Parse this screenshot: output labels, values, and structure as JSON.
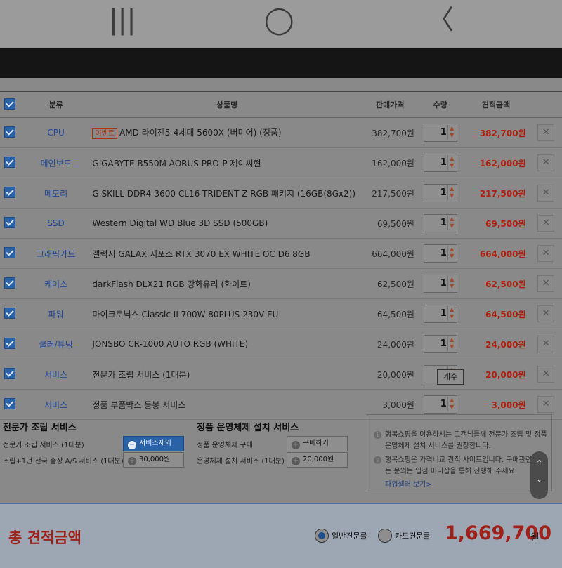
{
  "headers": {
    "select": "",
    "category": "분류",
    "product": "상품명",
    "price": "판매가격",
    "qty": "수량",
    "total": "견적금액"
  },
  "items": [
    {
      "category": "CPU",
      "badge": "이벤트",
      "name": "AMD 라이젠5-4세대 5600X (버미어) (정품)",
      "price": "382,700원",
      "qty": "1",
      "total": "382,700원"
    },
    {
      "category": "메인보드",
      "badge": "",
      "name": "GIGABYTE B550M AORUS PRO-P 제이씨현",
      "price": "162,000원",
      "qty": "1",
      "total": "162,000원"
    },
    {
      "category": "메모리",
      "badge": "",
      "name": "G.SKILL DDR4-3600 CL16 TRIDENT Z RGB 패키지 (16GB(8Gx2))",
      "price": "217,500원",
      "qty": "1",
      "total": "217,500원"
    },
    {
      "category": "SSD",
      "badge": "",
      "name": "Western Digital WD Blue 3D SSD (500GB)",
      "price": "69,500원",
      "qty": "1",
      "total": "69,500원"
    },
    {
      "category": "그래픽카드",
      "badge": "",
      "name": "갤럭시 GALAX 지포스 RTX 3070 EX WHITE OC D6 8GB",
      "price": "664,000원",
      "qty": "1",
      "total": "664,000원"
    },
    {
      "category": "케이스",
      "badge": "",
      "name": "darkFlash DLX21 RGB 강화유리 (화이트)",
      "price": "62,500원",
      "qty": "1",
      "total": "62,500원"
    },
    {
      "category": "파워",
      "badge": "",
      "name": "마이크로닉스 Classic II 700W 80PLUS 230V EU",
      "price": "64,500원",
      "qty": "1",
      "total": "64,500원"
    },
    {
      "category": "쿨러/튜닝",
      "badge": "",
      "name": "JONSBO CR-1000 AUTO RGB (WHITE)",
      "price": "24,000원",
      "qty": "1",
      "total": "24,000원"
    },
    {
      "category": "서비스",
      "badge": "",
      "name": "전문가 조립 서비스 (1대분)",
      "price": "20,000원",
      "qty": "1",
      "total": "20,000원"
    },
    {
      "category": "서비스",
      "badge": "",
      "name": "정품 부품박스 동봉 서비스",
      "price": "3,000원",
      "qty": "1",
      "total": "3,000원"
    }
  ],
  "tooltip": "개수",
  "delete_glyph": "✕",
  "assembly": {
    "title": "전문가 조립 서비스",
    "row1_label": "전문가 조립 서비스 (1대분)",
    "row1_button": "서비스제외",
    "row2_label": "조립+1년 전국 출장 A/S 서비스 (1대분)",
    "row2_button": "30,000원"
  },
  "os": {
    "title": "정품 운영체제 설치 서비스",
    "row1_label": "정품 운영체제 구매",
    "row1_button": "구매하기",
    "row2_label": "운영체제 설치 서비스 (1대분)",
    "row2_button": "20,000원"
  },
  "info": {
    "line1a": "행복쇼핑을 이용하시는 고객님들께 전문가 조립 및 정품",
    "line1b": "운영체제 설치 서비스를 권장합니다.",
    "line2a": "행복쇼핑은 가격비교 견적 사이트입니다. 구매관련 모",
    "line2b": "든 문의는 입점 미니샵을 통해 진행해 주세요.",
    "link": "파워셀러 보기>"
  },
  "footer": {
    "title": "총 견적금액",
    "radio1": "일반견문를",
    "radio2": "카드견문를",
    "amount": "1,669,700",
    "unit": "원"
  },
  "nav": {
    "recent": "|||",
    "home": "◯",
    "back": "〈"
  },
  "colors": {
    "accent_blue": "#2a62a8",
    "price_red": "#b0200f"
  }
}
